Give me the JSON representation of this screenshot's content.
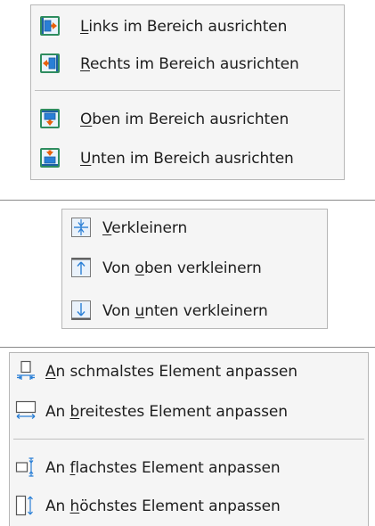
{
  "menu_align_area": {
    "items": [
      {
        "pre": "",
        "mnemonic": "L",
        "post": "inks im Bereich ausrichten",
        "icon": "align-left-area-icon"
      },
      {
        "pre": "",
        "mnemonic": "R",
        "post": "echts im Bereich ausrichten",
        "icon": "align-right-area-icon"
      },
      {
        "pre": "",
        "mnemonic": "O",
        "post": "ben im Bereich ausrichten",
        "icon": "align-top-area-icon"
      },
      {
        "pre": "",
        "mnemonic": "U",
        "post": "nten im Bereich ausrichten",
        "icon": "align-bottom-area-icon"
      }
    ]
  },
  "menu_shrink": {
    "items": [
      {
        "pre": "",
        "mnemonic": "V",
        "post": "erkleinern",
        "icon": "shrink-icon"
      },
      {
        "pre": "Von ",
        "mnemonic": "o",
        "post": "ben verkleinern",
        "icon": "shrink-from-top-icon"
      },
      {
        "pre": "Von ",
        "mnemonic": "u",
        "post": "nten verkleinern",
        "icon": "shrink-from-bottom-icon"
      }
    ]
  },
  "menu_size_to": {
    "items": [
      {
        "pre": "",
        "mnemonic": "A",
        "post": "n schmalstes Element anpassen",
        "icon": "fit-narrowest-icon"
      },
      {
        "pre": "An ",
        "mnemonic": "b",
        "post": "reitestes Element anpassen",
        "icon": "fit-widest-icon"
      },
      {
        "pre": "An ",
        "mnemonic": "f",
        "post": "lachstes Element anpassen",
        "icon": "fit-shortest-icon"
      },
      {
        "pre": "An ",
        "mnemonic": "h",
        "post": "öchstes Element anpassen",
        "icon": "fit-tallest-icon"
      }
    ]
  },
  "colors": {
    "menu_bg": "#f5f5f5",
    "menu_border": "#b7b7b7",
    "text": "#1d1d1d",
    "icon_blue": "#2a7fd6",
    "icon_orange": "#e8600a",
    "icon_green_frame": "#2f8d5f"
  }
}
